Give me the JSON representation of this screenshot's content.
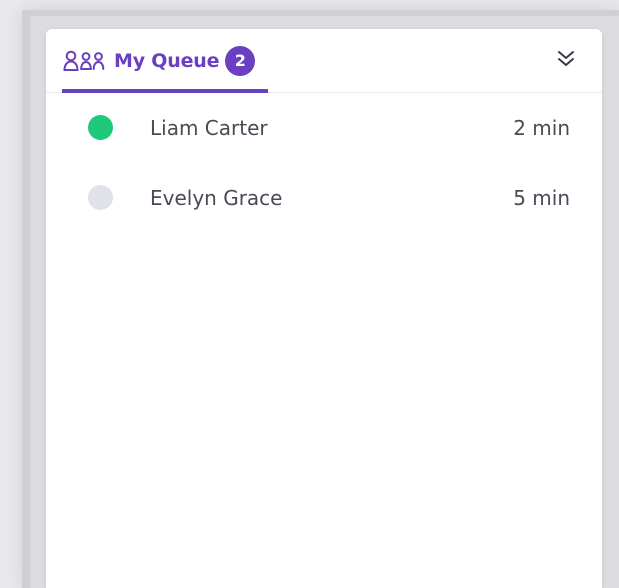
{
  "header": {
    "tab_label": "My Queue",
    "queue_count": "2",
    "queue_icon": "people-group-icon",
    "collapse_icon": "double-chevron-down-icon"
  },
  "queue": [
    {
      "name": "Liam Carter",
      "wait": "2 min",
      "status": "online",
      "status_color": "#1ec97a"
    },
    {
      "name": "Evelyn Grace",
      "wait": "5 min",
      "status": "offline",
      "status_color": "#e1e1ea"
    }
  ],
  "colors": {
    "accent": "#6a3fc1",
    "text": "#4a4a55",
    "divider": "#ebebef"
  }
}
